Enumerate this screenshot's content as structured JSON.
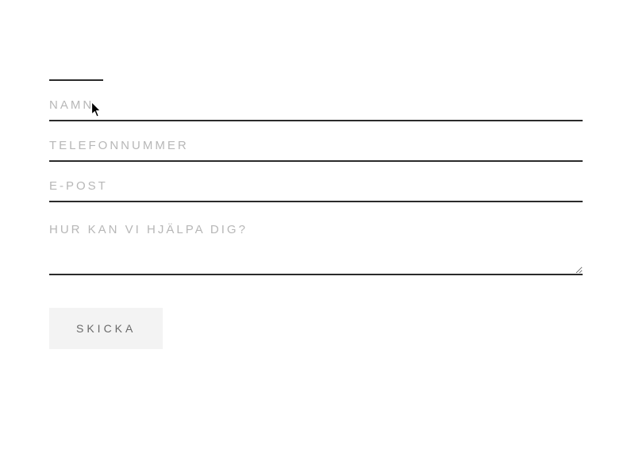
{
  "form": {
    "fields": {
      "name": {
        "placeholder": "NAMN",
        "value": ""
      },
      "phone": {
        "placeholder": "TELEFONNUMMER",
        "value": ""
      },
      "email": {
        "placeholder": "E-POST",
        "value": ""
      },
      "message": {
        "placeholder": "HUR KAN VI HJÄLPA DIG?",
        "value": ""
      }
    },
    "submit_label": "SKICKA"
  }
}
